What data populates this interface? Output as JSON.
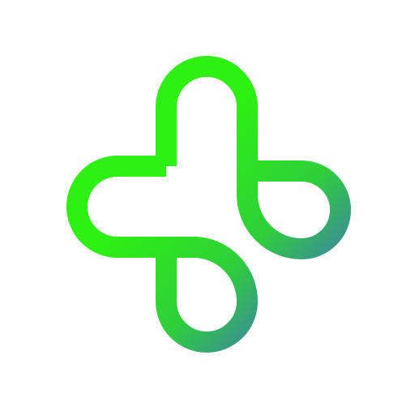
{
  "icon": {
    "name": "plus-cross-logo-icon",
    "gradient_start": "#2ef012",
    "gradient_mid": "#2ecf3a",
    "gradient_end": "#4b4ff0"
  }
}
